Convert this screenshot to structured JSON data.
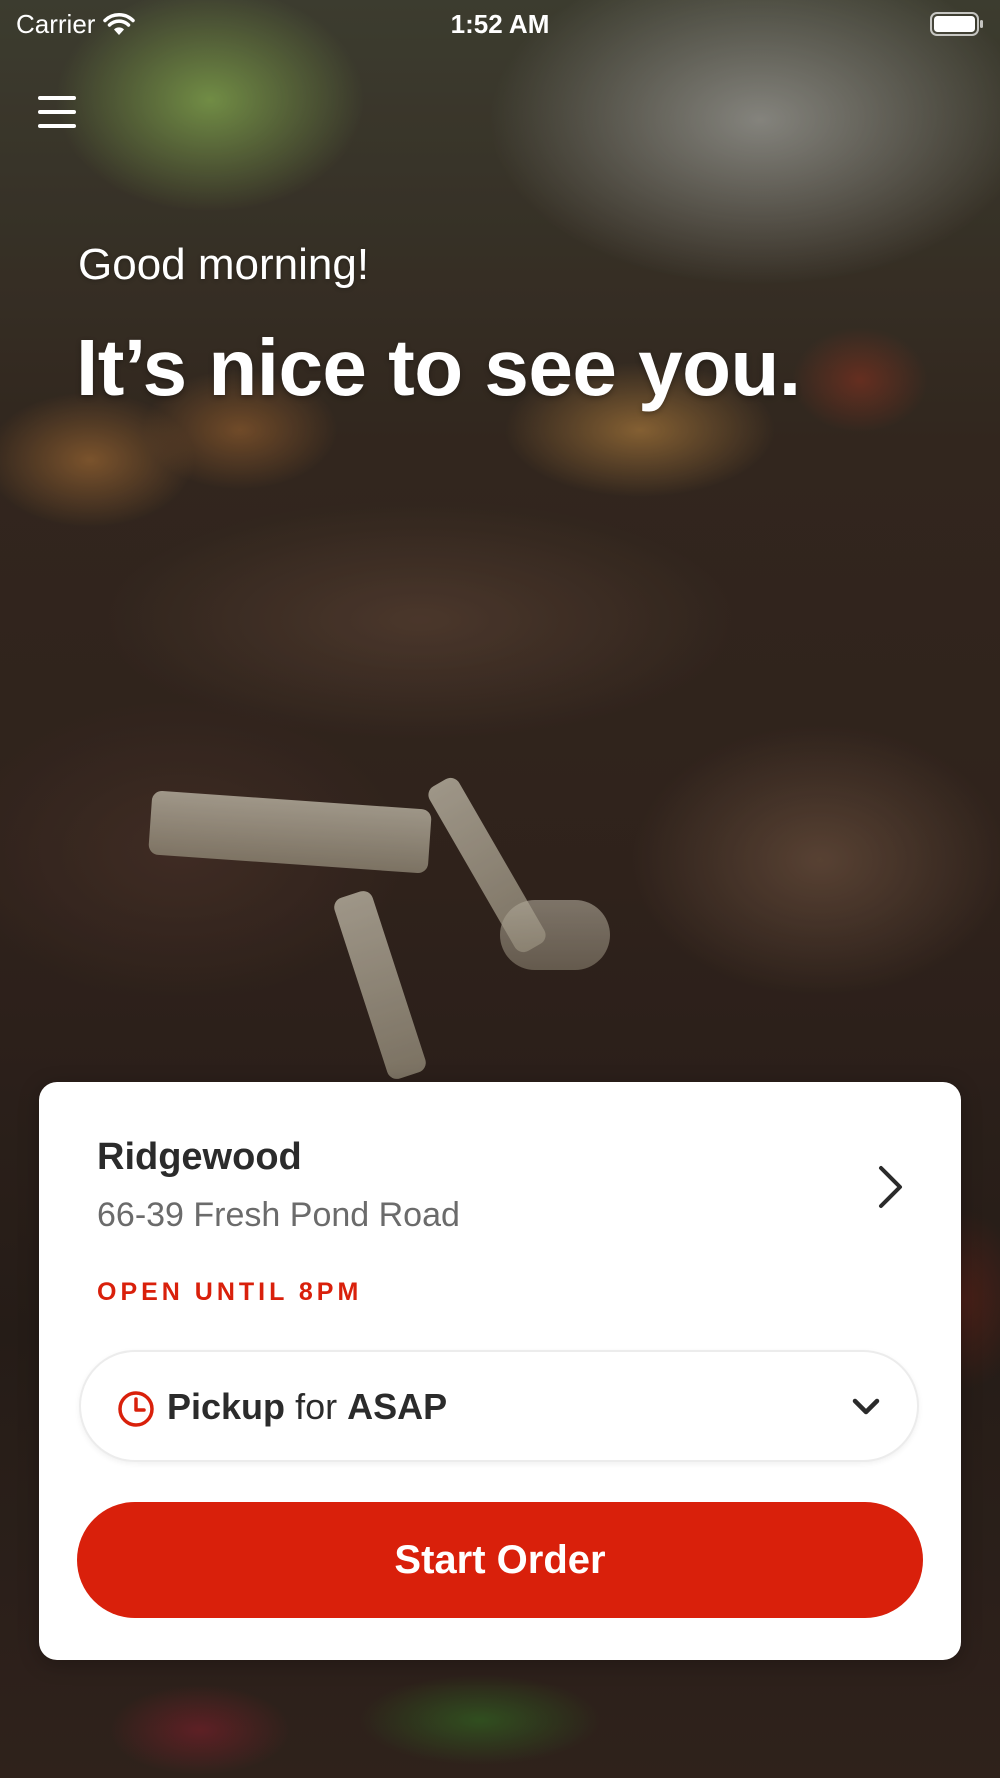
{
  "status_bar": {
    "carrier": "Carrier",
    "time": "1:52 AM"
  },
  "hero": {
    "greeting": "Good morning!",
    "headline": "It’s nice to see you."
  },
  "location": {
    "name": "Ridgewood",
    "address": "66-39 Fresh Pond Road",
    "open_status": "OPEN UNTIL 8PM"
  },
  "order_type": {
    "mode": "Pickup",
    "connector": "for",
    "when": "ASAP"
  },
  "actions": {
    "start_order_label": "Start Order"
  },
  "icons": {
    "menu": "hamburger-menu-icon",
    "wifi": "wifi-icon",
    "battery": "battery-icon",
    "clock": "clock-icon",
    "chevron_right": "chevron-right-icon",
    "chevron_down": "chevron-down-icon"
  },
  "colors": {
    "accent": "#d9200b",
    "card_bg": "#ffffff",
    "primary_text": "#2b2b2b",
    "secondary_text": "#6b6b6b"
  }
}
